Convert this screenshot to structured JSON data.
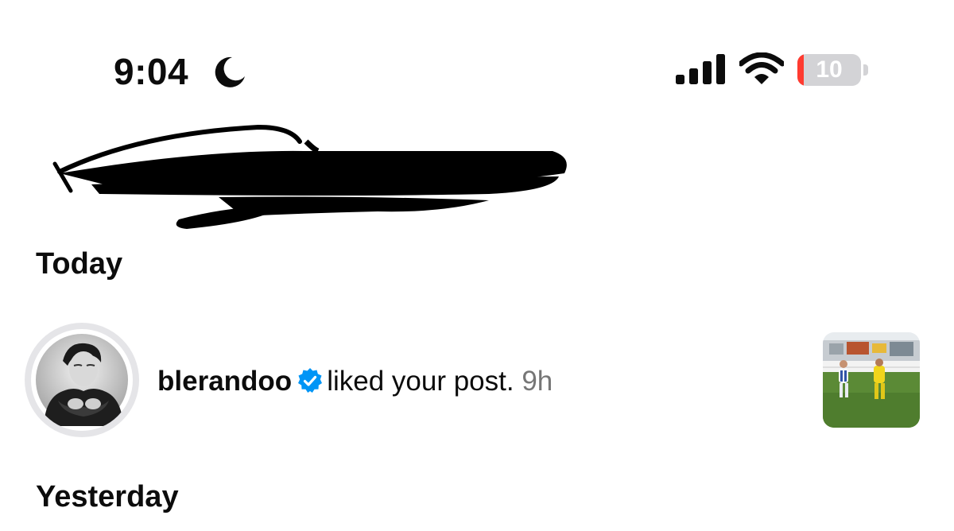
{
  "status_bar": {
    "time": "9:04",
    "focus_icon": "moon-icon",
    "signal_icon": "cellular-signal-icon",
    "wifi_icon": "wifi-icon",
    "battery": {
      "level_text": "10",
      "level_percent": 10,
      "color": "#ff3b30"
    }
  },
  "header": {
    "redacted": true
  },
  "sections": {
    "today": "Today",
    "yesterday": "Yesterday"
  },
  "notifications": [
    {
      "username": "blerandoo",
      "verified": true,
      "verified_color": "#0095f6",
      "action": "liked your post.",
      "time": "9h",
      "avatar_icon": "profile-photo",
      "thumbnail_icon": "post-thumbnail"
    }
  ]
}
